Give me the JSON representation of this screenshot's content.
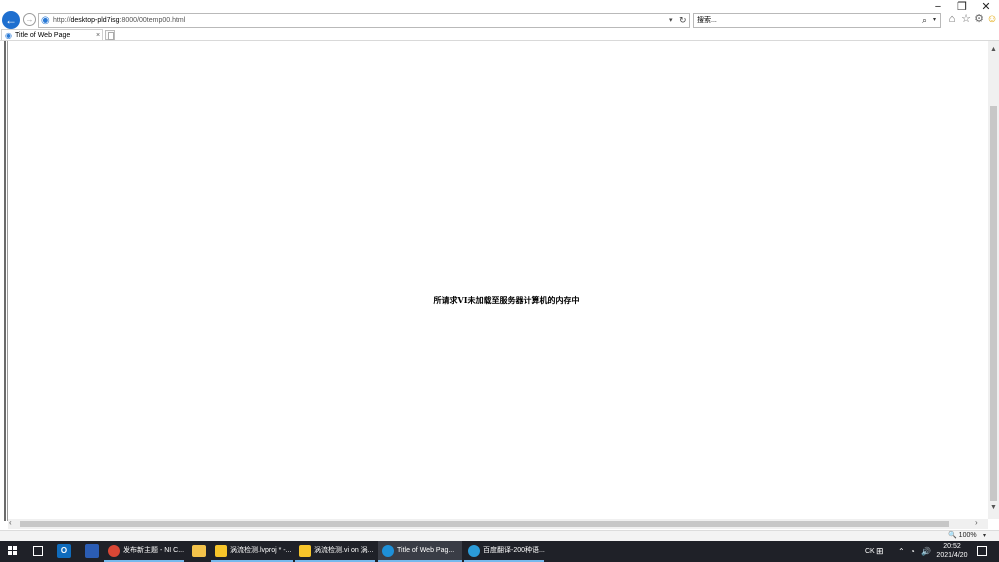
{
  "window": {
    "minimize": "−",
    "maximize": "❐",
    "close": "✕"
  },
  "toolbar": {
    "back": "←",
    "forward": "→",
    "url_prefix": "http://",
    "url_host": "desktop-pld7isg",
    "url_rest": ":8000/00temp00.html",
    "search_placeholder": "搜索...",
    "icons": [
      "back-icon",
      "forward-icon",
      "page-icon",
      "refresh-icon",
      "search-icon",
      "home-icon",
      "star-icon",
      "gear-icon",
      "smiley-icon"
    ]
  },
  "tab": {
    "title": "Title of Web Page",
    "close": "×"
  },
  "content": {
    "message": "所请求VI未加载至服务器计算机的内存中"
  },
  "statusbar": {
    "zoom": "100%"
  },
  "taskbar": {
    "tasks": [
      {
        "label": "发布新主题 - NI C..."
      },
      {
        "label": "涡流检测.lvproj * -..."
      },
      {
        "label": "涡流检测.vi on 涡..."
      },
      {
        "label": "Title of Web Pag..."
      },
      {
        "label": "百度翻译-200种语..."
      }
    ],
    "tray": {
      "ime_mode": "CK",
      "ime_icon": "⊞",
      "time": "20:52",
      "date": "2021/4/20"
    }
  }
}
